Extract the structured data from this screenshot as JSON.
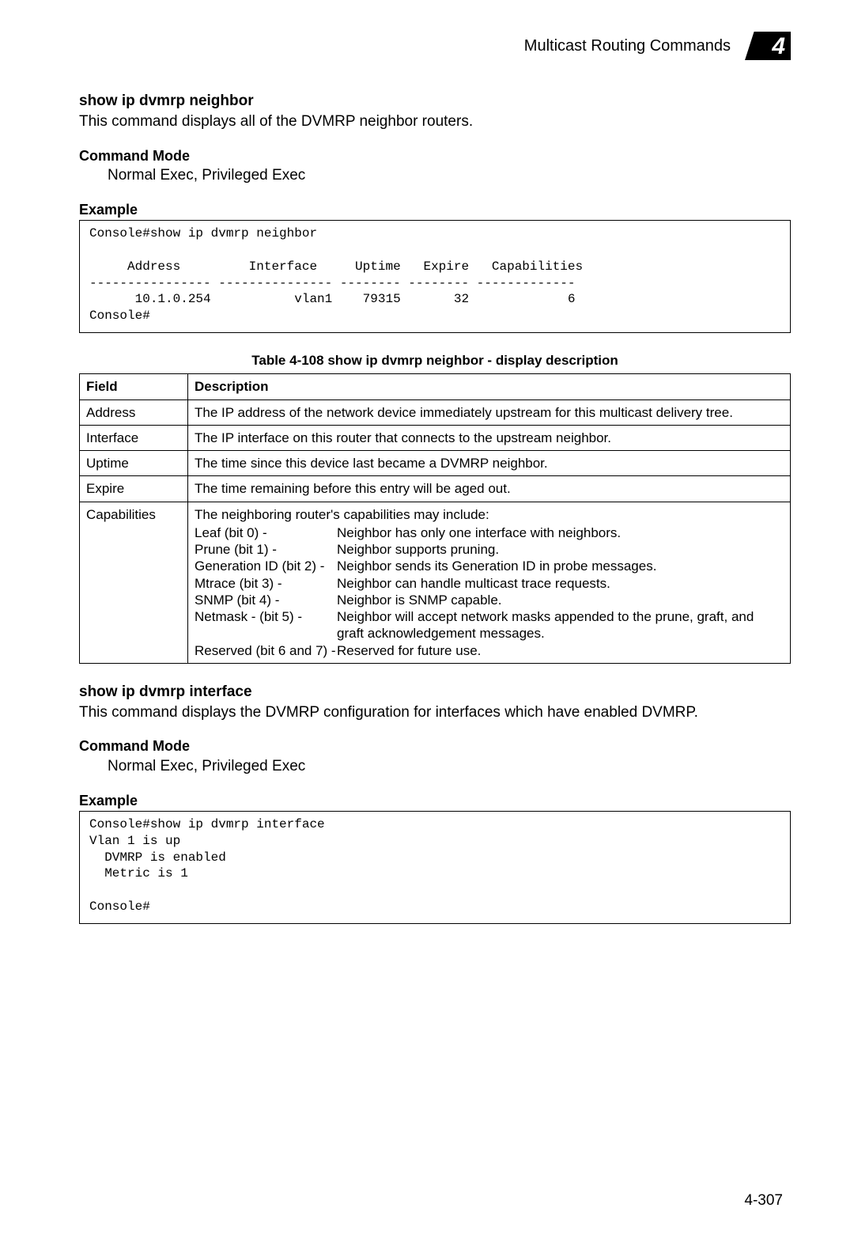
{
  "header": {
    "title": "Multicast Routing Commands",
    "chapter_number": "4"
  },
  "section1": {
    "command": "show ip dvmrp neighbor",
    "description": "This command displays all of the DVMRP neighbor routers.",
    "mode_heading": "Command Mode",
    "mode_value": "Normal Exec, Privileged Exec",
    "example_heading": "Example",
    "console_output": "Console#show ip dvmrp neighbor\n\n     Address         Interface     Uptime   Expire   Capabilities\n---------------- --------------- -------- -------- -------------\n      10.1.0.254           vlan1    79315       32             6\nConsole#"
  },
  "table": {
    "caption": "Table 4-108   show ip dvmrp neighbor - display description",
    "header_field": "Field",
    "header_desc": "Description",
    "rows": [
      {
        "field": "Address",
        "desc": "The IP address of the network device immediately upstream for this multicast delivery tree."
      },
      {
        "field": "Interface",
        "desc": "The IP interface on this router that connects to the upstream neighbor."
      },
      {
        "field": "Uptime",
        "desc": "The time since this device last became a DVMRP neighbor."
      },
      {
        "field": "Expire",
        "desc": "The time remaining before this entry will be aged out."
      }
    ],
    "capabilities": {
      "field": "Capabilities",
      "intro": "The neighboring router's capabilities may include:",
      "items": [
        {
          "label": "Leaf (bit 0) -",
          "meaning": "Neighbor has only one interface with neighbors."
        },
        {
          "label": "Prune (bit 1) -",
          "meaning": "Neighbor supports pruning."
        },
        {
          "label": "Generation ID (bit 2) -",
          "meaning": "Neighbor sends its Generation ID in probe messages."
        },
        {
          "label": "Mtrace (bit 3) -",
          "meaning": "Neighbor can handle multicast trace requests."
        },
        {
          "label": "SNMP (bit 4) -",
          "meaning": "Neighbor is SNMP capable."
        },
        {
          "label": "Netmask - (bit 5) -",
          "meaning": "Neighbor will accept network masks appended to the prune, graft, and graft acknowledgement messages."
        },
        {
          "label": "Reserved (bit 6 and 7) -",
          "meaning": "Reserved for future use."
        }
      ]
    }
  },
  "section2": {
    "command": "show ip dvmrp interface",
    "description": "This command displays the DVMRP configuration for interfaces which have enabled DVMRP.",
    "mode_heading": "Command Mode",
    "mode_value": "Normal Exec, Privileged Exec",
    "example_heading": "Example",
    "console_output": "Console#show ip dvmrp interface\nVlan 1 is up\n  DVMRP is enabled\n  Metric is 1\n\nConsole#"
  },
  "footer": {
    "page_number": "4-307"
  }
}
